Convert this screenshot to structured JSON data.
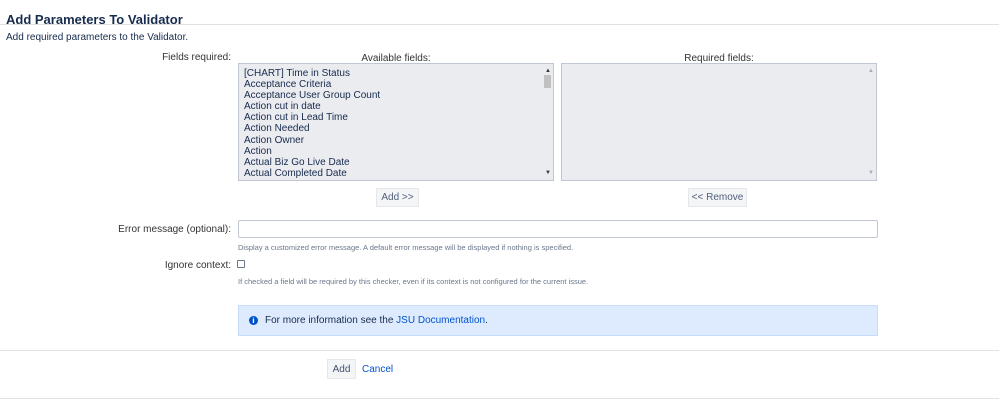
{
  "page": {
    "title": "Add Parameters To Validator",
    "description": "Add required parameters to the Validator."
  },
  "fields": {
    "label": "Fields required:",
    "available_header": "Available fields:",
    "required_header": "Required fields:",
    "available_items": [
      "[CHART] Time in Status",
      "Acceptance Criteria",
      "Acceptance User Group Count",
      "Action cut in date",
      "Action cut in Lead Time",
      "Action Needed",
      "Action Owner",
      "Action",
      "Actual Biz Go Live Date",
      "Actual Completed Date"
    ],
    "required_items": [],
    "add_button": "Add >>",
    "remove_button": "<< Remove"
  },
  "error_message": {
    "label": "Error message (optional):",
    "value": "",
    "hint": "Display a customized error message. A default error message will be displayed if nothing is specified."
  },
  "ignore_context": {
    "label": "Ignore context:",
    "checked": false,
    "hint": "If checked a field will be required by this checker, even if its context is not configured for the current issue."
  },
  "info": {
    "prefix": "For more information see the",
    "link": "JSU Documentation",
    "suffix": "."
  },
  "footer": {
    "add": "Add",
    "cancel": "Cancel"
  },
  "colors": {
    "link": "#0052cc",
    "info_bg": "#deebff",
    "listbox_bg": "#ebecf0"
  }
}
